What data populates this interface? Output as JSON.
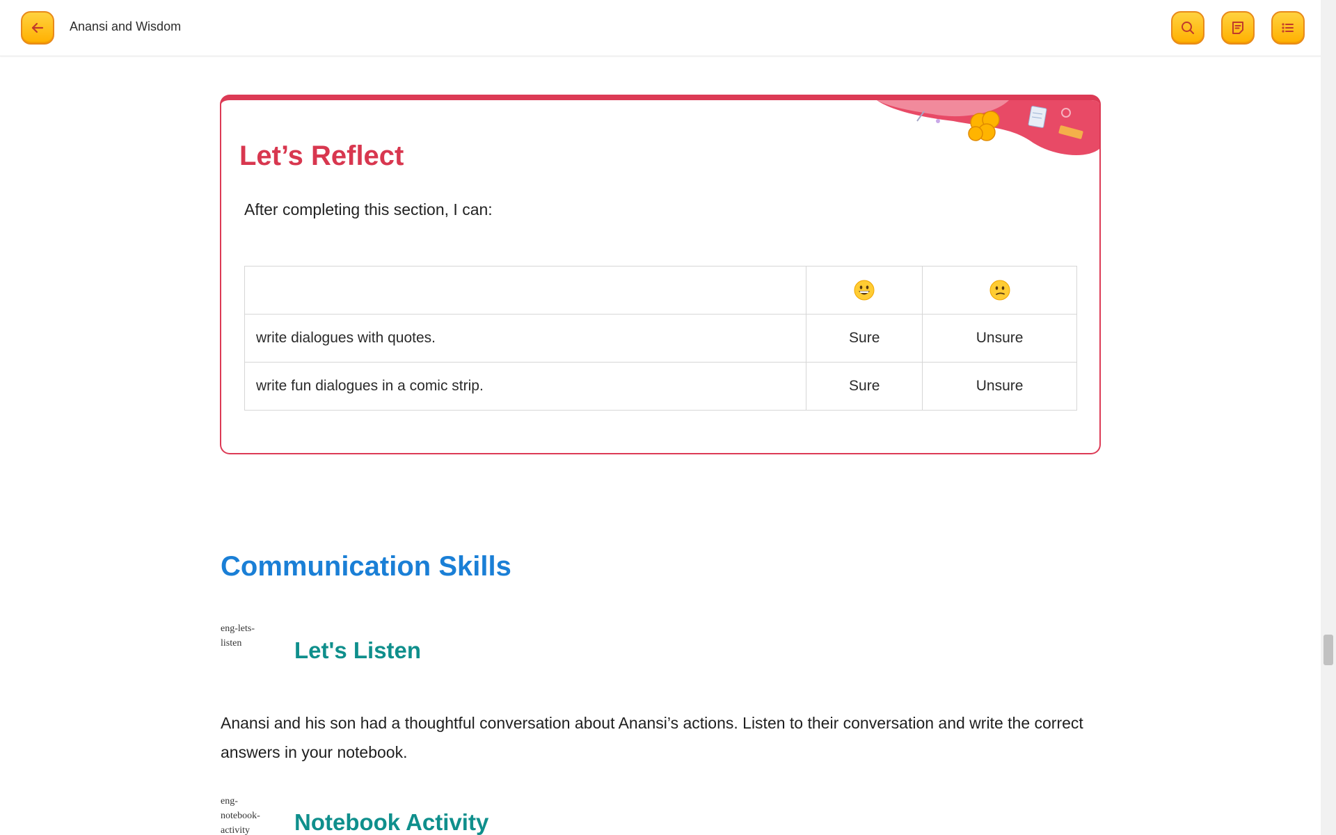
{
  "header": {
    "title": "Anansi and Wisdom",
    "back_icon": "arrow-left-icon",
    "search_icon": "search-icon",
    "notes_icon": "notes-icon",
    "menu_icon": "list-icon",
    "button_color": "#ffbf1f"
  },
  "reflect": {
    "title": "Let’s Reflect",
    "intro": "After completing this section, I can:",
    "accent_color": "#dc3a55",
    "columns": [
      {
        "icon": "grinning-face-emoji"
      },
      {
        "icon": "confused-face-emoji"
      }
    ],
    "rows": [
      {
        "skill": "write dialogues with quotes.",
        "sure": "Sure",
        "unsure": "Unsure"
      },
      {
        "skill": "write fun dialogues in a comic strip.",
        "sure": "Sure",
        "unsure": "Unsure"
      }
    ]
  },
  "communication": {
    "title": "Communication Skills",
    "listen": {
      "image_alt": "eng-lets-listen",
      "title": "Let's Listen",
      "paragraph": "Anansi and his son had a thoughtful conversation about Anansi’s actions. Listen to their conversation and write the correct answers in your notebook."
    },
    "notebook": {
      "image_alt": "eng-notebook-activity",
      "title": "Notebook Activity"
    }
  }
}
